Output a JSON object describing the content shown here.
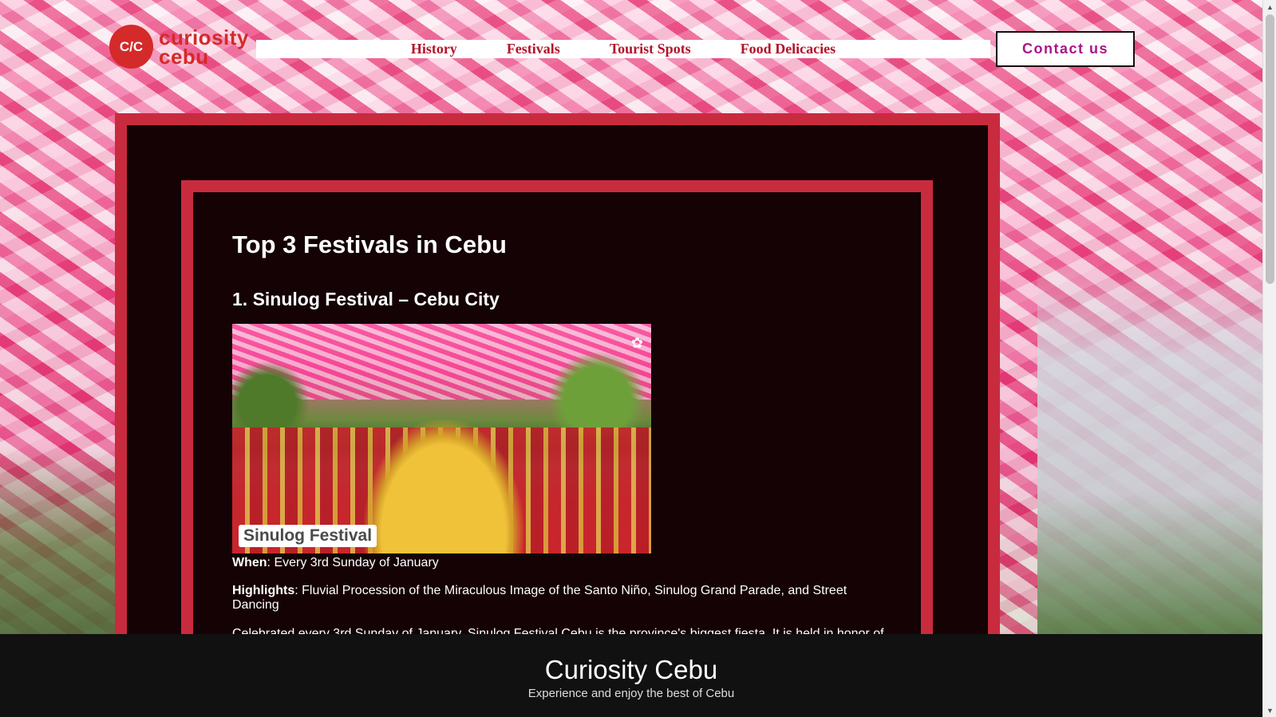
{
  "logo": {
    "mark": "C/C",
    "line1": "curiosity",
    "line2": "cebu"
  },
  "nav": {
    "items": [
      "History",
      "Festivals",
      "Tourist Spots",
      "Food Delicacies"
    ]
  },
  "contact": {
    "label": "Contact us"
  },
  "main": {
    "title": "Top 3 Festivals in Cebu",
    "festival_heading": "1. Sinulog Festival – Cebu City",
    "photo_caption": "Sinulog Festival",
    "when_label": "When",
    "when_value": ": Every 3rd Sunday of January",
    "highlights_label": "Highlights",
    "highlights_value": ": Fluvial Procession of the Miraculous Image of the Santo Niño, Sinulog Grand Parade, and Street Dancing",
    "description": "Celebrated every 3rd Sunday of January, Sinulog Festival Cebu is the province's biggest fiesta. It is held in honor of"
  },
  "footer": {
    "title": "Curiosity Cebu",
    "tagline": "Experience and enjoy the best of Cebu"
  },
  "scrollbar": {
    "up_arrow": "▲",
    "down_arrow": "▼"
  },
  "colors": {
    "accent_red": "#c92b3e",
    "panel_dark": "#140205",
    "nav_text": "#b2142a",
    "contact_text": "#a8168a"
  }
}
